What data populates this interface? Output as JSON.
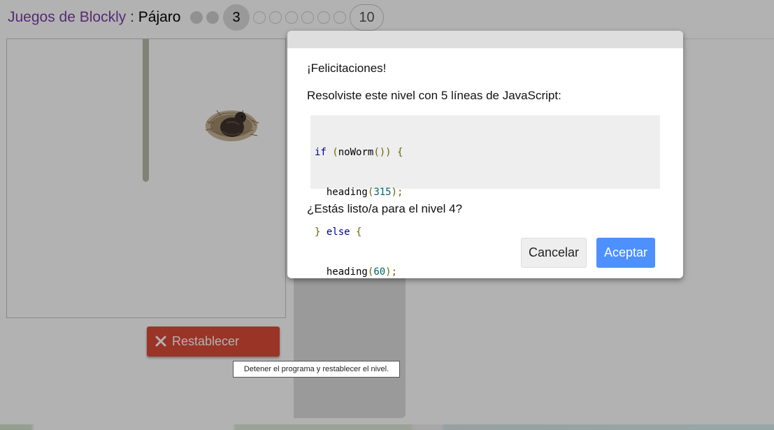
{
  "header": {
    "app_title": "Juegos de Blockly",
    "separator": " : ",
    "game_name": "Pájaro",
    "current_level": "3",
    "last_level": "10"
  },
  "reset_button": {
    "label": "Restablecer",
    "icon": "close-icon",
    "color": "#dd4b39"
  },
  "tooltip": {
    "text": "Detener el programa y restablecer el nivel."
  },
  "dialog": {
    "heading": "¡Felicitaciones!",
    "summary": "Resolviste este nivel con 5 líneas de JavaScript:",
    "code_lines": [
      "if (noWorm()) {",
      "  heading(315);",
      "} else {",
      "  heading(60);",
      "}"
    ],
    "question": "¿Estás listo/a para el nivel 4?",
    "cancel_label": "Cancelar",
    "accept_label": "Aceptar",
    "accept_color": "#4d90fe"
  },
  "colors": {
    "brand": "#7b3ea6",
    "wall": "#b8bba8"
  }
}
